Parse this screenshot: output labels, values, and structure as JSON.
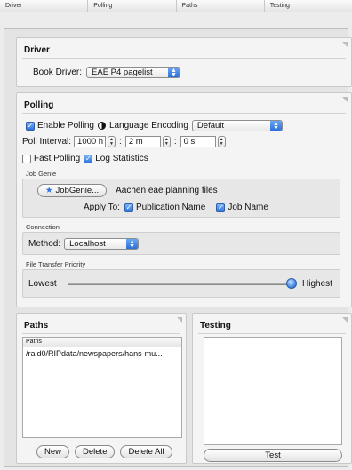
{
  "tabs": [
    "Driver",
    "Polling",
    "Paths",
    "Testing"
  ],
  "driver": {
    "title": "Driver",
    "book_driver_label": "Book Driver:",
    "book_driver_value": "EAE P4 pagelist"
  },
  "polling": {
    "title": "Polling",
    "enable_polling_label": "Enable Polling",
    "language_encoding_label": "Language Encoding",
    "language_encoding_value": "Default",
    "poll_interval_label": "Poll Interval:",
    "hours_value": "1000 h",
    "minutes_value": "2 m",
    "seconds_value": "0 s",
    "separator": ":",
    "fast_polling_label": "Fast Polling",
    "log_statistics_label": "Log Statistics",
    "job_genie": {
      "group_label": "Job Genie",
      "button_label": "JobGenie...",
      "genie_name": "Aachen eae planning files",
      "apply_to_label": "Apply To:",
      "publication_name_label": "Publication Name",
      "job_name_label": "Job Name"
    },
    "connection": {
      "group_label": "Connection",
      "method_label": "Method:",
      "method_value": "Localhost"
    },
    "transfer": {
      "group_label": "File Transfer Priority",
      "lowest_label": "Lowest",
      "highest_label": "Highest",
      "priority_level": 1.0
    }
  },
  "paths": {
    "title": "Paths",
    "list_header": "Paths",
    "items": [
      "/raid0/RIPdata/newspapers/hans-mu..."
    ],
    "new_label": "New",
    "delete_label": "Delete",
    "delete_all_label": "Delete All"
  },
  "testing": {
    "title": "Testing",
    "test_label": "Test"
  }
}
